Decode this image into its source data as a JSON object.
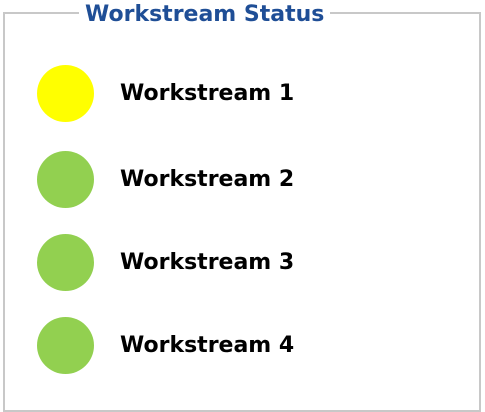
{
  "title": "Workstream Status",
  "colors": {
    "title": "#1f4e96",
    "border": "#c8c8c8",
    "yellow": "#ffff00",
    "green": "#92d050"
  },
  "workstreams": [
    {
      "label": "Workstream 1",
      "status": "yellow",
      "color": "#ffff00"
    },
    {
      "label": "Workstream 2",
      "status": "green",
      "color": "#92d050"
    },
    {
      "label": "Workstream 3",
      "status": "green",
      "color": "#92d050"
    },
    {
      "label": "Workstream 4",
      "status": "green",
      "color": "#92d050"
    }
  ]
}
